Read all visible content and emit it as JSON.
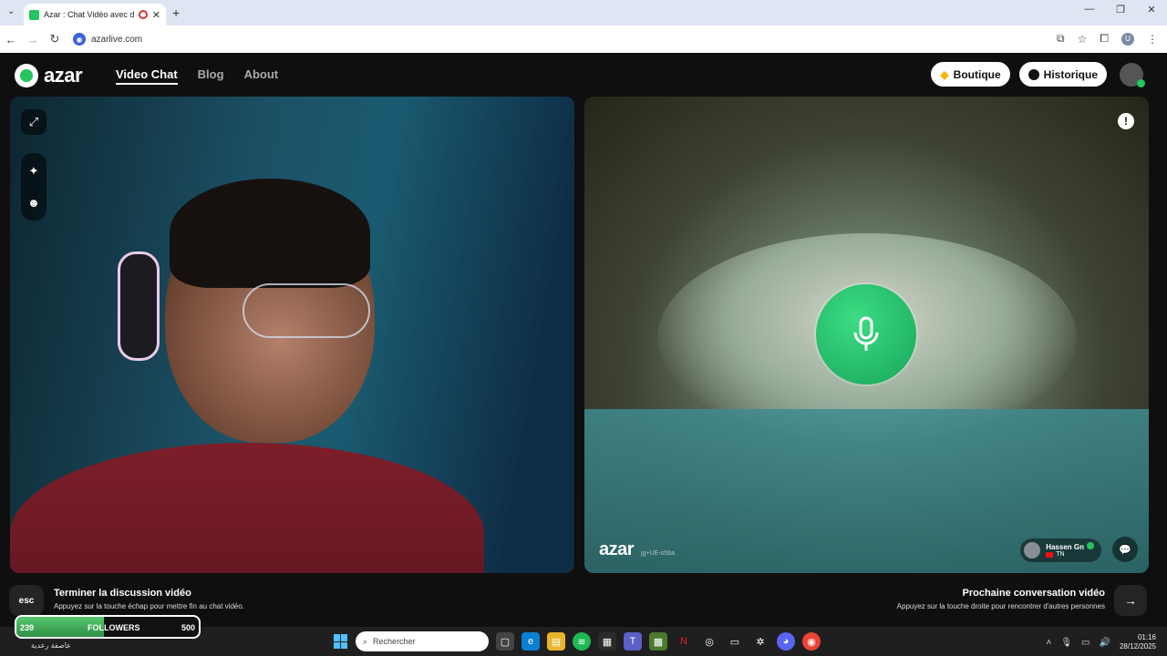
{
  "browser": {
    "tab_title": "Azar : Chat Vidéo avec de",
    "url": "azarlive.com",
    "new_tab_glyph": "+",
    "tab_close_glyph": "✕",
    "window_controls": [
      "—",
      "❐",
      "✕"
    ],
    "profile_initial": "U"
  },
  "header": {
    "logo_text": "azar",
    "nav": [
      {
        "label": "Video Chat",
        "active": true
      },
      {
        "label": "Blog",
        "active": false
      },
      {
        "label": "About",
        "active": false
      }
    ],
    "boutique_label": "Boutique",
    "historique_label": "Historique"
  },
  "remote": {
    "watermark_logo": "azar",
    "watermark_id": "jg+UE-o5ba",
    "peer_name": "Hassen Gn",
    "peer_country": "TN",
    "report_glyph": "!"
  },
  "footer": {
    "esc_label": "esc",
    "end_title": "Terminer la discussion vidéo",
    "end_sub": "Appuyez sur la touche échap pour mettre fin au chat vidéo.",
    "next_title": "Prochaine conversation vidéo",
    "next_sub": "Appuyez sur la touche droite pour rencontrer d'autres personnes",
    "next_glyph": "→"
  },
  "overlay": {
    "current": "239",
    "label": "FOLLOWERS",
    "goal": "500",
    "progress": 0.478
  },
  "taskbar": {
    "weather_text": "عاصفة رعدية",
    "search_placeholder": "Rechercher",
    "time": "01:16",
    "date": "28/12/2025"
  },
  "colors": {
    "accent": "#22c55e",
    "header_bg": "#0f0f0f"
  }
}
